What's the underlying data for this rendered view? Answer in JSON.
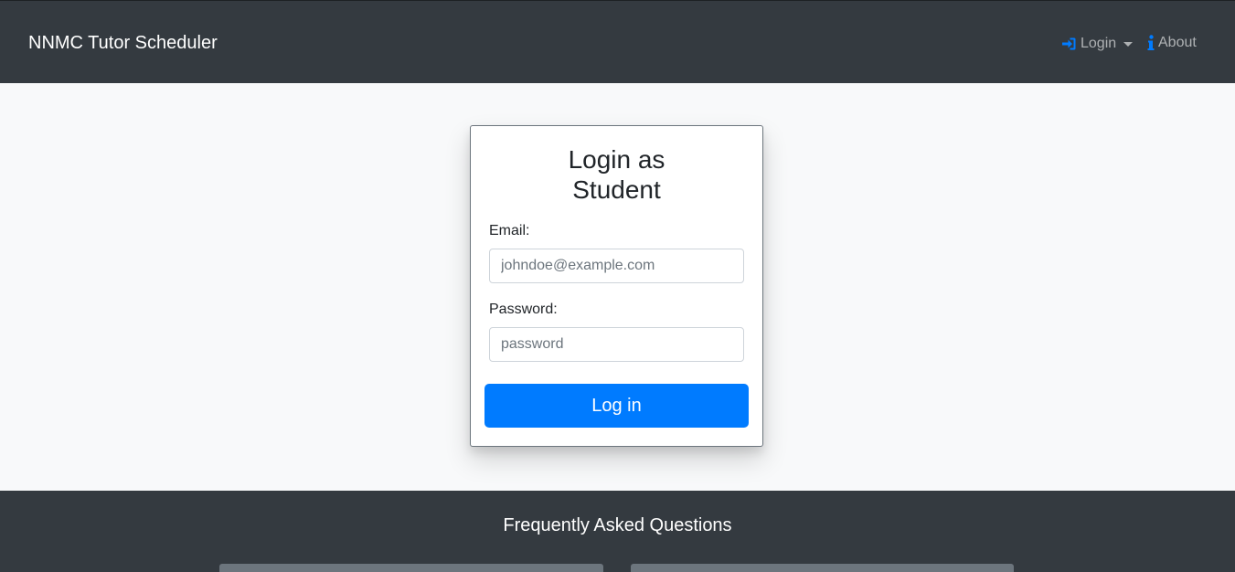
{
  "navbar": {
    "brand": "NNMC Tutor Scheduler",
    "login_label": "Login",
    "about_label": "About"
  },
  "login_form": {
    "title": "Login as Student",
    "email_label": "Email:",
    "email_placeholder": "johndoe@example.com",
    "email_value": "",
    "password_label": "Password:",
    "password_placeholder": "password",
    "password_value": "",
    "submit_label": "Log in"
  },
  "footer": {
    "faq_title": "Frequently Asked Questions"
  },
  "colors": {
    "navbar_bg": "#343a40",
    "accent": "#007bff",
    "page_bg": "#f8f9fa"
  }
}
